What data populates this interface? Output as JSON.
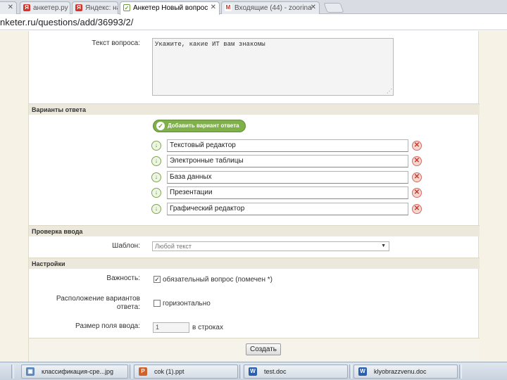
{
  "browser": {
    "tabs": [
      {
        "label": "анкетер.ру",
        "icon": "yandex-icon"
      },
      {
        "label": "Яндекс: на",
        "icon": "yandex-icon"
      },
      {
        "label": "Анкетер   Новый вопрос",
        "icon": "page-icon",
        "active": true
      },
      {
        "label": "Входящие (44) - zoorina",
        "icon": "gmail-icon"
      }
    ],
    "address": "nketer.ru/questions/add/36993/2/"
  },
  "form": {
    "question_label": "Текст вопроса:",
    "question_text": "Укажите, какие ИТ вам знакомы",
    "answers_header": "Варианты ответа",
    "add_answer_button": "Добавить вариант ответа",
    "answers": [
      "Текстовый редактор",
      "Электронные таблицы",
      "База данных",
      "Презентации",
      "Графический редактор"
    ],
    "validation_header": "Проверка ввода",
    "template_label": "Шаблон:",
    "template_value": "Любой текст",
    "settings_header": "Настройки",
    "importance_label": "Важность:",
    "required_text": "обязательный вопрос (помечен *)",
    "required_checked": true,
    "layout_label_line1": "Расположение вариантов",
    "layout_label_line2": "ответа:",
    "horizontal_text": "горизонтально",
    "horizontal_checked": false,
    "field_size_label": "Размер поля ввода:",
    "field_size_value": "1",
    "field_size_unit": "в строках",
    "submit_label": "Создать"
  },
  "taskbar": {
    "items": [
      {
        "label": "классификация-сре...jpg",
        "icon": "image-icon"
      },
      {
        "label": "cok (1).ppt",
        "icon": "powerpoint-icon"
      },
      {
        "label": "test.doc",
        "icon": "word-icon"
      },
      {
        "label": "klyobrazzvenu.doc",
        "icon": "word-icon"
      }
    ]
  }
}
